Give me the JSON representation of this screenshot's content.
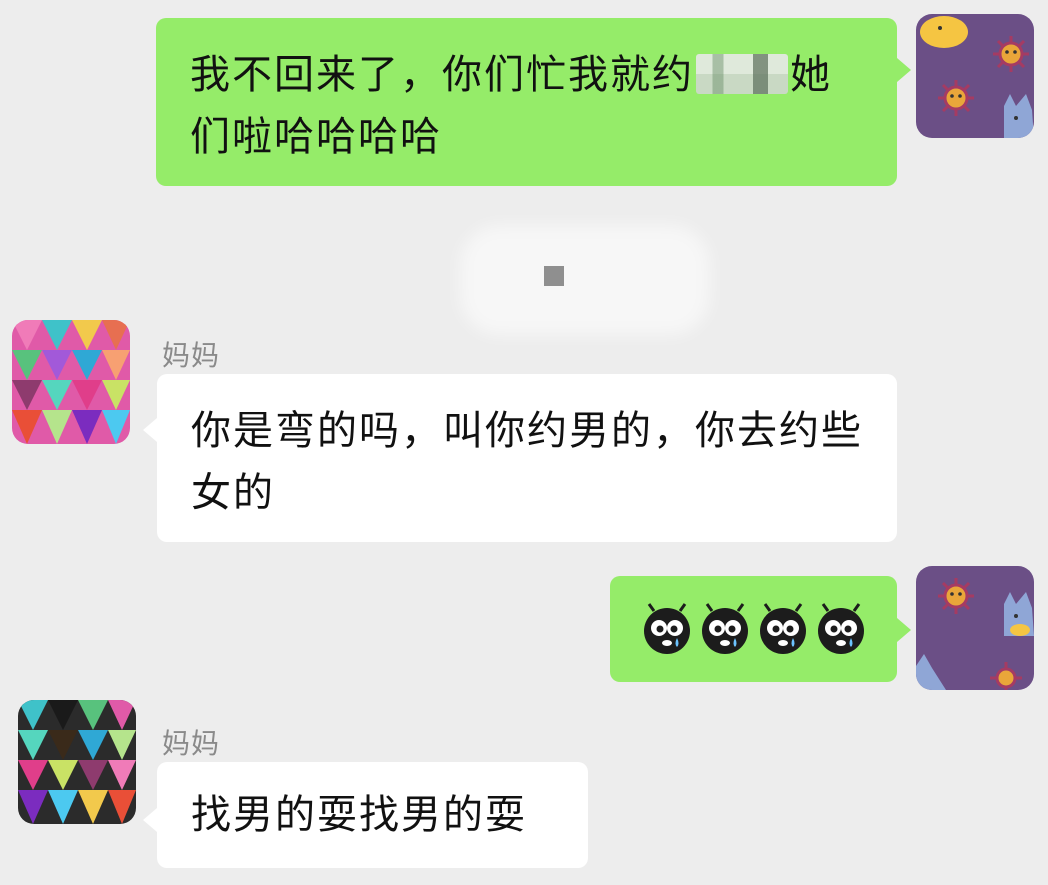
{
  "chat": {
    "messages": [
      {
        "direction": "sent",
        "text_before": "我不回来了，你们忙我就约",
        "redacted": true,
        "text_after": "她们啦哈哈哈哈"
      },
      {
        "direction": "received",
        "sender": "妈妈",
        "text": "你是弯的吗，叫你约男的，你去约些女的"
      },
      {
        "direction": "sent",
        "emoji": [
          "crying-face-emoji",
          "crying-face-emoji",
          "crying-face-emoji",
          "crying-face-emoji"
        ]
      },
      {
        "direction": "received",
        "sender": "妈妈",
        "text": "找男的耍找男的耍"
      }
    ]
  },
  "colors": {
    "background": "#ededed",
    "sent_bubble": "#95ec69",
    "received_bubble": "#ffffff",
    "sender_name": "#8a8a8a",
    "text": "#111111",
    "avatar_self_bg": "#6b4f86"
  }
}
